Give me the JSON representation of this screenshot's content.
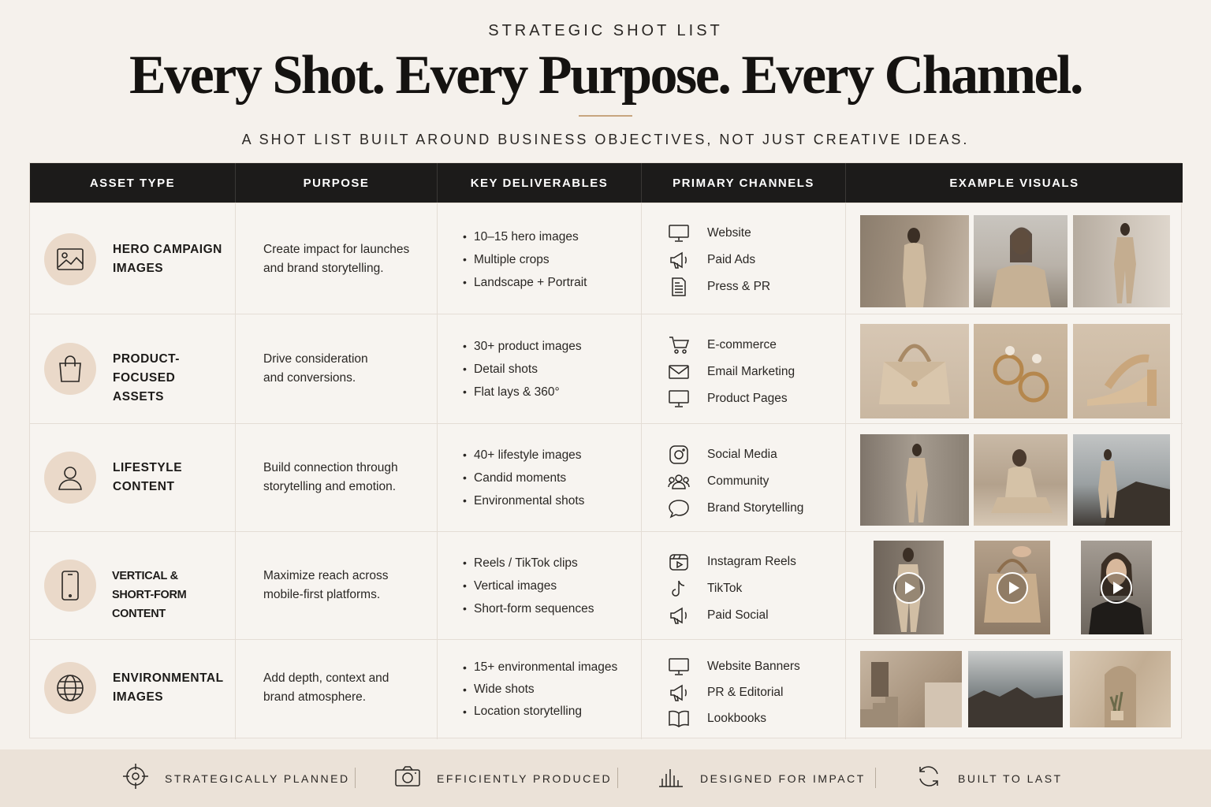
{
  "header": {
    "eyebrow": "STRATEGIC SHOT LIST",
    "headline": "Every Shot. Every Purpose. Every Channel.",
    "subline": "A SHOT LIST BUILT AROUND BUSINESS OBJECTIVES, NOT JUST CREATIVE IDEAS."
  },
  "table": {
    "columns": [
      "ASSET TYPE",
      "PURPOSE",
      "KEY DELIVERABLES",
      "PRIMARY CHANNELS",
      "EXAMPLE VISUALS"
    ],
    "rows": [
      {
        "icon": "image-icon",
        "asset_line1": "HERO CAMPAIGN",
        "asset_line2": "IMAGES",
        "purpose_line1": "Create impact for launches",
        "purpose_line2": "and brand storytelling.",
        "deliverables": [
          "10–15 hero images",
          "Multiple crops",
          "Landscape + Portrait"
        ],
        "channels": [
          {
            "icon": "monitor-icon",
            "label": "Website"
          },
          {
            "icon": "megaphone-icon",
            "label": "Paid Ads"
          },
          {
            "icon": "newspaper-icon",
            "label": "Press & PR"
          }
        ],
        "visuals": [
          "woman-beige-suit-wall",
          "woman-beige-suit-sea",
          "woman-beige-suit-full"
        ]
      },
      {
        "icon": "shopping-bag-icon",
        "asset_line1": "PRODUCT-FOCUSED",
        "asset_line2": "ASSETS",
        "purpose_line1": "Drive consideration",
        "purpose_line2": "and conversions.",
        "deliverables": [
          "30+ product images",
          "Detail shots",
          "Flat lays & 360°"
        ],
        "channels": [
          {
            "icon": "cart-icon",
            "label": "E-commerce"
          },
          {
            "icon": "envelope-icon",
            "label": "Email Marketing"
          },
          {
            "icon": "monitor-icon",
            "label": "Product Pages"
          }
        ],
        "visuals": [
          "beige-handbag",
          "gold-hoop-earrings",
          "beige-heeled-sandal"
        ]
      },
      {
        "icon": "user-icon",
        "asset_line1": "LIFESTYLE",
        "asset_line2": "CONTENT",
        "purpose_line1": "Build connection through",
        "purpose_line2": "storytelling and emotion.",
        "deliverables": [
          "40+ lifestyle images",
          "Candid moments",
          "Environmental shots"
        ],
        "channels": [
          {
            "icon": "instagram-icon",
            "label": "Social Media"
          },
          {
            "icon": "community-icon",
            "label": "Community"
          },
          {
            "icon": "speech-bubble-icon",
            "label": "Brand Storytelling"
          }
        ],
        "visuals": [
          "woman-suit-corridor",
          "woman-seated-beach",
          "woman-rocks-coast"
        ]
      },
      {
        "icon": "smartphone-icon",
        "asset_line1": "VERTICAL &",
        "asset_line2": "SHORT-FORM CONTENT",
        "purpose_line1": "Maximize reach across",
        "purpose_line2": "mobile-first platforms.",
        "deliverables": [
          "Reels / TikTok clips",
          "Vertical images",
          "Short-form sequences"
        ],
        "channels": [
          {
            "icon": "video-play-icon",
            "label": "Instagram Reels"
          },
          {
            "icon": "tiktok-icon",
            "label": "TikTok"
          },
          {
            "icon": "megaphone-icon",
            "label": "Paid Social"
          }
        ],
        "visuals": [
          "video-woman-suit",
          "video-handbag-hands",
          "video-woman-portrait"
        ]
      },
      {
        "icon": "globe-icon",
        "asset_line1": "ENVIRONMENTAL",
        "asset_line2": "IMAGES",
        "purpose_line1": "Add depth, context and",
        "purpose_line2": "brand atmosphere.",
        "deliverables": [
          "15+ environmental images",
          "Wide shots",
          "Location storytelling"
        ],
        "channels": [
          {
            "icon": "monitor-icon",
            "label": "Website Banners"
          },
          {
            "icon": "megaphone-icon",
            "label": "PR & Editorial"
          },
          {
            "icon": "book-icon",
            "label": "Lookbooks"
          }
        ],
        "visuals": [
          "stone-staircase-courtyard",
          "rocky-seascape",
          "arched-alcove-plant"
        ]
      }
    ]
  },
  "footer": [
    {
      "icon": "crosshair-icon",
      "label": "STRATEGICALLY PLANNED"
    },
    {
      "icon": "camera-icon",
      "label": "EFFICIENTLY PRODUCED"
    },
    {
      "icon": "bar-chart-icon",
      "label": "DESIGNED FOR IMPACT"
    },
    {
      "icon": "refresh-icon",
      "label": "BUILT TO LAST"
    }
  ],
  "colors": {
    "background": "#f5f1ec",
    "header_bar": "#1c1b1a",
    "accent_circle": "#ead9c9",
    "accent_rule": "#c7a57e",
    "footer_band": "#ebe2d8"
  }
}
